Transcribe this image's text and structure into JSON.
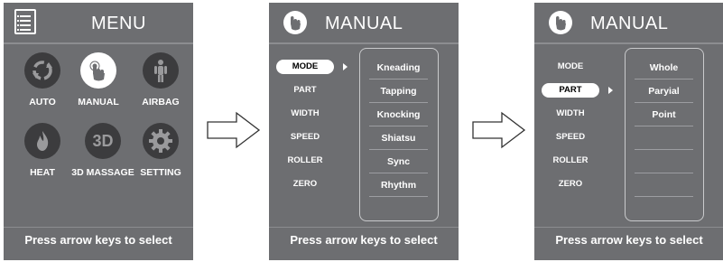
{
  "footer_text": "Press arrow keys to select",
  "menu_screen": {
    "title": "MENU",
    "tiles": [
      {
        "label": "AUTO",
        "icon": "auto-cycle-icon",
        "active": false
      },
      {
        "label": "MANUAL",
        "icon": "hand-icon",
        "active": true
      },
      {
        "label": "AIRBAG",
        "icon": "body-airbag-icon",
        "active": false
      },
      {
        "label": "HEAT",
        "icon": "flame-icon",
        "active": false
      },
      {
        "label": "3D MASSAGE",
        "icon": "3d-icon",
        "icon_text": "3D",
        "active": false
      },
      {
        "label": "SETTING",
        "icon": "gear-icon",
        "active": false
      }
    ]
  },
  "manual_mode_screen": {
    "title": "MANUAL",
    "left_items": [
      "MODE",
      "PART",
      "WIDTH",
      "SPEED",
      "ROLLER",
      "ZERO"
    ],
    "selected": "MODE",
    "options": [
      "Kneading",
      "Tapping",
      "Knocking",
      "Shiatsu",
      "Sync",
      "Rhythm"
    ]
  },
  "manual_part_screen": {
    "title": "MANUAL",
    "left_items": [
      "MODE",
      "PART",
      "WIDTH",
      "SPEED",
      "ROLLER",
      "ZERO"
    ],
    "selected": "PART",
    "options": [
      "Whole",
      "Paryial",
      "Point"
    ]
  },
  "colors": {
    "panel": "#6d6e71",
    "icon_circle": "#3c3c3e",
    "text": "#ffffff",
    "highlight": "#ffffff"
  }
}
